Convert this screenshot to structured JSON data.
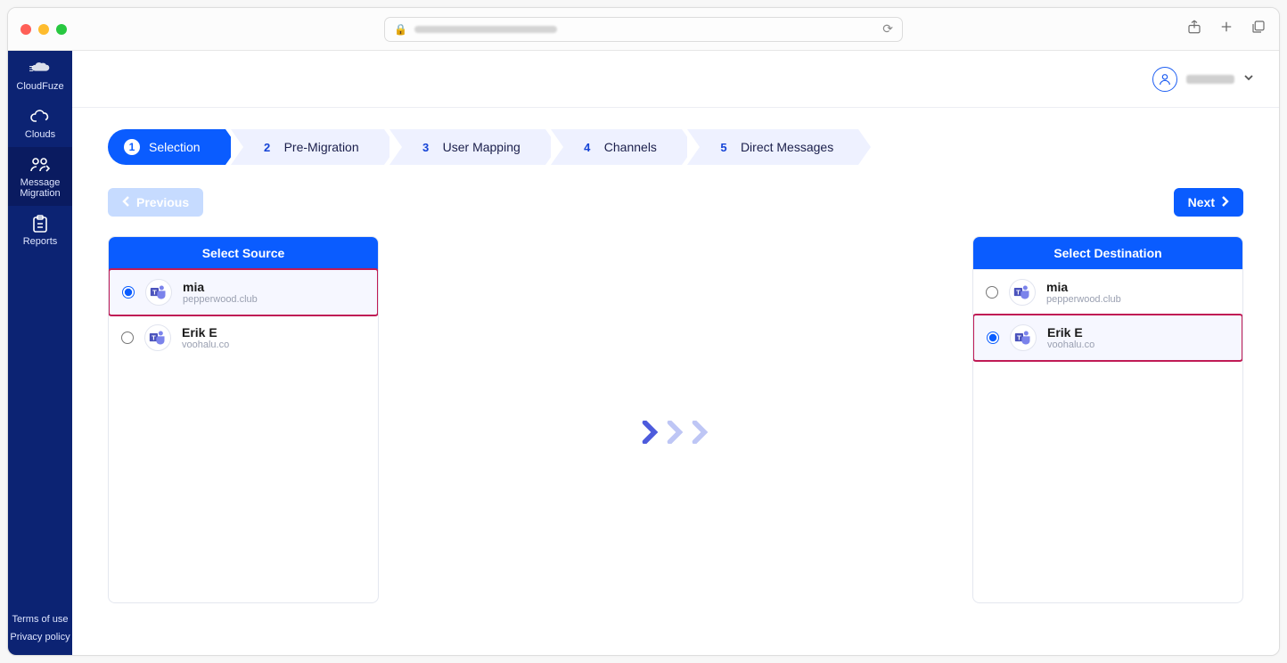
{
  "sidebar": {
    "brand": "CloudFuze",
    "items": [
      {
        "label": "CloudFuze"
      },
      {
        "label": "Clouds"
      },
      {
        "label": "Message\nMigration"
      },
      {
        "label": "Reports"
      }
    ],
    "footer": [
      "Terms of use",
      "Privacy policy"
    ]
  },
  "stepper": [
    {
      "num": "1",
      "label": "Selection"
    },
    {
      "num": "2",
      "label": "Pre-Migration"
    },
    {
      "num": "3",
      "label": "User Mapping"
    },
    {
      "num": "4",
      "label": "Channels"
    },
    {
      "num": "5",
      "label": "Direct Messages"
    }
  ],
  "buttons": {
    "previous": "Previous",
    "next": "Next"
  },
  "source": {
    "title": "Select Source",
    "accounts": [
      {
        "name": "mia",
        "domain": "pepperwood.club",
        "selected": true
      },
      {
        "name": "Erik E",
        "domain": "voohalu.co",
        "selected": false
      }
    ]
  },
  "destination": {
    "title": "Select Destination",
    "accounts": [
      {
        "name": "mia",
        "domain": "pepperwood.club",
        "selected": false
      },
      {
        "name": "Erik E",
        "domain": "voohalu.co",
        "selected": true
      }
    ]
  },
  "icons": {
    "accountApp": "microsoft-teams"
  },
  "colors": {
    "accent": "#0a5cff",
    "sidebar": "#0c2373",
    "highlight": "#c01b55"
  }
}
